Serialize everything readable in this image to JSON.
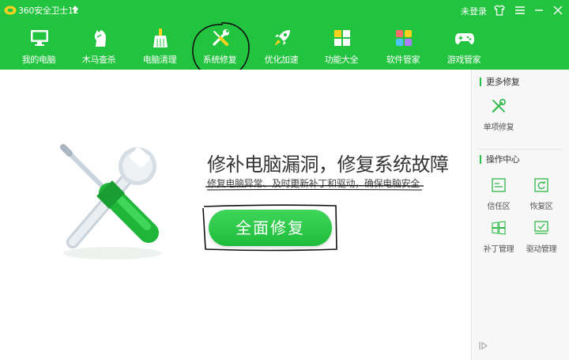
{
  "app": {
    "title": "360安全卫士12",
    "login_text": "未登录"
  },
  "window_controls": {
    "icons": [
      "skin-icon",
      "menu-icon",
      "minimize-icon",
      "close-icon"
    ]
  },
  "nav": {
    "items": [
      {
        "label": "我的电脑",
        "icon": "monitor-icon"
      },
      {
        "label": "木马查杀",
        "icon": "horse-icon"
      },
      {
        "label": "电脑清理",
        "icon": "broom-icon"
      },
      {
        "label": "系统修复",
        "icon": "wrench-screwdriver-icon",
        "active": true
      },
      {
        "label": "优化加速",
        "icon": "rocket-icon"
      },
      {
        "label": "功能大全",
        "icon": "grid-icon"
      },
      {
        "label": "软件管家",
        "icon": "apps-icon"
      },
      {
        "label": "游戏管家",
        "icon": "gamepad-icon"
      }
    ]
  },
  "main": {
    "title": "修补电脑漏洞，修复系统故障",
    "subtitle": "修复电脑异常、及时更新补丁和驱动，确保电脑安全",
    "repair_button": "全面修复"
  },
  "side": {
    "more_repair": {
      "heading": "更多修复",
      "items": [
        {
          "label": "单项修复",
          "icon": "wrench-screwdriver-icon"
        }
      ]
    },
    "operations": {
      "heading": "操作中心",
      "items": [
        {
          "label": "信任区",
          "icon": "trust-zone-icon"
        },
        {
          "label": "恢复区",
          "icon": "restore-zone-icon"
        },
        {
          "label": "补丁管理",
          "icon": "windows-patch-icon"
        },
        {
          "label": "驱动管理",
          "icon": "driver-icon"
        }
      ]
    }
  },
  "colors": {
    "brand_green": "#22c43f",
    "button_green": "#2fcb4b",
    "annotation_ink": "#000000"
  }
}
